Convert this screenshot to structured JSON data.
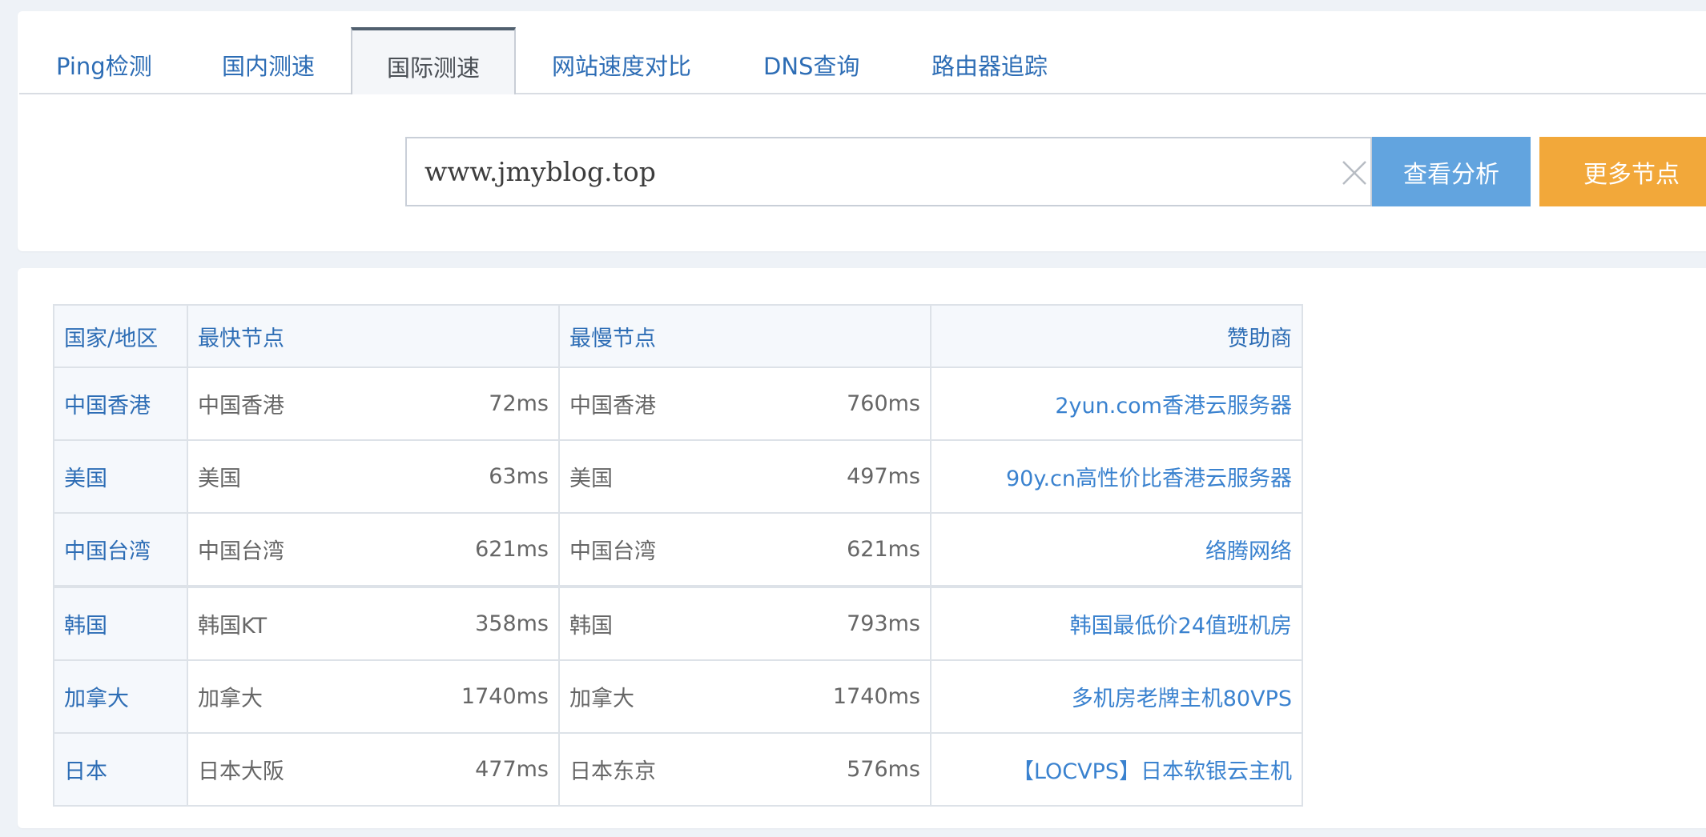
{
  "tabs": [
    {
      "label": "Ping检测",
      "active": false
    },
    {
      "label": "国内测速",
      "active": false
    },
    {
      "label": "国际测速",
      "active": true
    },
    {
      "label": "网站速度对比",
      "active": false
    },
    {
      "label": "DNS查询",
      "active": false
    },
    {
      "label": "路由器追踪",
      "active": false
    }
  ],
  "search": {
    "value": "www.jmyblog.top",
    "clear_icon": "close-icon",
    "analyze_label": "查看分析",
    "more_label": "更多节点"
  },
  "colors": {
    "accent_blue": "#62a4df",
    "accent_orange": "#f2a83a",
    "link_blue": "#2d6db5"
  },
  "table": {
    "headers": [
      "国家/地区",
      "最快节点",
      "最慢节点",
      "赞助商"
    ],
    "rows": [
      {
        "region": "中国香港",
        "fastest_node": "中国香港",
        "fastest_time": "72ms",
        "slowest_node": "中国香港",
        "slowest_time": "760ms",
        "sponsor": "2yun.com香港云服务器"
      },
      {
        "region": "美国",
        "fastest_node": "美国",
        "fastest_time": "63ms",
        "slowest_node": "美国",
        "slowest_time": "497ms",
        "sponsor": "90y.cn高性价比香港云服务器"
      },
      {
        "region": "中国台湾",
        "fastest_node": "中国台湾",
        "fastest_time": "621ms",
        "slowest_node": "中国台湾",
        "slowest_time": "621ms",
        "sponsor": "络腾网络"
      },
      {
        "region": "韩国",
        "fastest_node": "韩国KT",
        "fastest_time": "358ms",
        "slowest_node": "韩国",
        "slowest_time": "793ms",
        "sponsor": "韩国最低价24值班机房"
      },
      {
        "region": "加拿大",
        "fastest_node": "加拿大",
        "fastest_time": "1740ms",
        "slowest_node": "加拿大",
        "slowest_time": "1740ms",
        "sponsor": "多机房老牌主机80VPS"
      },
      {
        "region": "日本",
        "fastest_node": "日本大阪",
        "fastest_time": "477ms",
        "slowest_node": "日本东京",
        "slowest_time": "576ms",
        "sponsor": "【LOCVPS】日本软银云主机"
      }
    ]
  }
}
